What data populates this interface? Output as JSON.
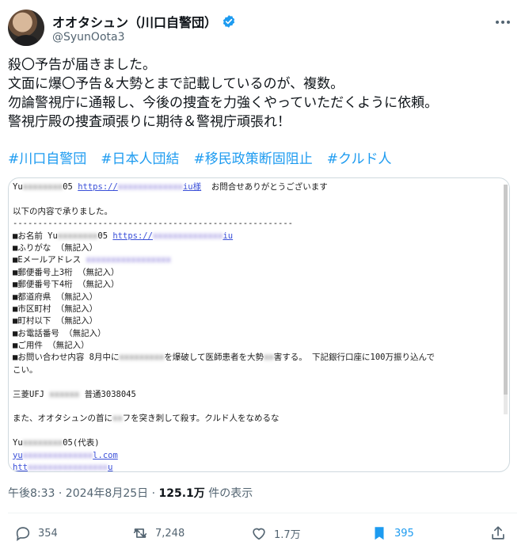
{
  "author": {
    "name": "オオタシュン（川口自警団）",
    "handle": "@SyunOota3"
  },
  "post": {
    "lines": [
      "殺〇予告が届きました。",
      "文面に爆〇予告＆大勢とまで記載しているのが、複数。",
      "勿論警視庁に通報し、今後の捜査を力強くやっていただくように依頼。",
      "警視庁殿の捜査頑張りに期待＆警視庁頑張れ！"
    ],
    "hashtags": [
      "#川口自警団",
      "#日本人団結",
      "#移民政策断固阻止",
      "#クルド人"
    ]
  },
  "attachment": {
    "line1_prefix": "Yu",
    "line1_mid": "05",
    "line1_link": "https://",
    "line1_link_end": "iu様",
    "line1_suffix": "お問合せありがとうございます",
    "received": "以下の内容で承りました。",
    "separator": "--------------------------------------------------------",
    "name_label": "■お名前 Yu",
    "name_mid": "05",
    "name_link": "https://",
    "name_link_end": "iu",
    "furigana": "■ふりがな （無記入）",
    "email_label": "■Eメールアドレス",
    "zip3": "■郵便番号上3桁 （無記入）",
    "zip4": "■郵便番号下4桁 （無記入）",
    "pref": "■都道府県 （無記入）",
    "city": "■市区町村 （無記入）",
    "town": "■町村以下 （無記入）",
    "phone": "■お電話番号 （無記入）",
    "subject": "■ご用件 （無記入）",
    "inquiry_a": "■お問い合わせ内容 8月中に",
    "inquiry_b": "を爆破して医師患者を大勢",
    "inquiry_c": "害する。 下記銀行口座に100万振り込んで",
    "inquiry_d": "こい。",
    "bank_a": "三菱UFJ",
    "bank_b": "普通3038045",
    "also_a": "また、オオタシュンの首に",
    "also_b": "フを突き刺して殺す。クルド人をなめるな",
    "sig_a": "Yu",
    "sig_b": "05(代表)",
    "sig_mail_a": "yu",
    "sig_mail_b": "l.com",
    "sig_url_a": "htt",
    "sig_url_b": "u"
  },
  "meta": {
    "time": "午後8:33 · 2024年8月25日 · ",
    "views": "125.1万",
    "views_suffix": " 件の表示"
  },
  "actions": {
    "replies": "354",
    "reposts": "7,248",
    "likes": "1.7万",
    "bookmarks": "395"
  },
  "colors": {
    "link": "#1d9bf0",
    "muted": "#536471"
  }
}
